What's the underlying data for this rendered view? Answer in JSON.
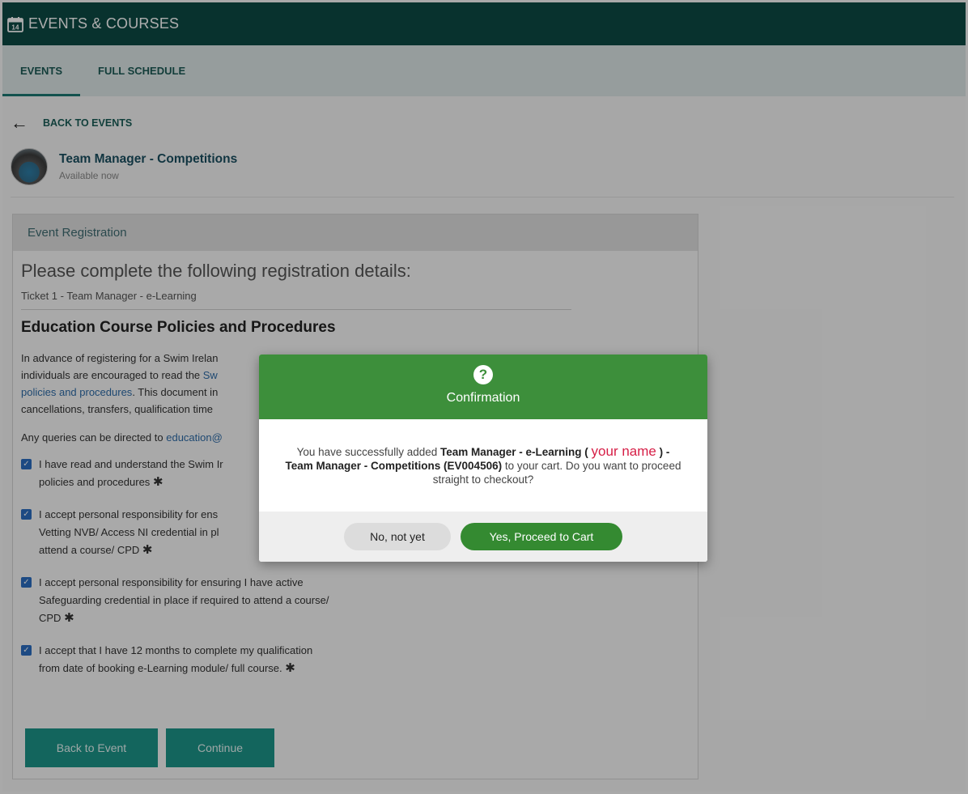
{
  "header": {
    "title": "EVENTS & COURSES",
    "icon": "calendar-icon"
  },
  "tabs": [
    {
      "label": "EVENTS",
      "active": true
    },
    {
      "label": "FULL SCHEDULE",
      "active": false
    }
  ],
  "back": {
    "label": "BACK TO EVENTS"
  },
  "event": {
    "title": "Team Manager - Competitions",
    "status": "Available now"
  },
  "registration": {
    "card_title": "Event Registration",
    "lead": "Please complete the following registration details:",
    "ticket": "Ticket 1 - Team Manager - e-Learning",
    "policy_title": "Education Course Policies and Procedures",
    "para1_a": "In advance of registering for a Swim Irelan",
    "para1_b": "individuals are encouraged to read the ",
    "para1_link_a": "Sw",
    "para1_link_b": "policies and procedures",
    "para1_c": ". This document in",
    "para1_d": "cancellations, transfers, qualification time",
    "para2_text": "Any queries can be directed to ",
    "para2_link": "education@",
    "checks": [
      {
        "line1": "I have read and understand the Swim Ir",
        "line2": "policies and procedures",
        "checked": true
      },
      {
        "line1": "I accept personal responsibility for ens",
        "line2": "Vetting NVB/ Access NI credential in pl",
        "line3": "attend a course/ CPD",
        "checked": true
      },
      {
        "line1": "I accept personal responsibility for ensuring I have active",
        "line2": "Safeguarding credential in place if required to attend a course/",
        "line3": "CPD",
        "checked": true
      },
      {
        "line1": "I accept that I have 12 months to complete my qualification",
        "line2": "from date of booking e-Learning module/ full course.",
        "checked": true
      }
    ],
    "required_mark": "✱",
    "buttons": {
      "back": "Back to Event",
      "continue": "Continue"
    }
  },
  "modal": {
    "icon": "question-icon",
    "title": "Confirmation",
    "msg_prefix": "You have successfully added ",
    "msg_bold1": "Team Manager - e-Learning (",
    "msg_red": "your name",
    "msg_bold2": ") - Team Manager - Competitions (EV004506)",
    "msg_suffix": " to your cart. Do you want to proceed straight to checkout?",
    "no_label": "No, not yet",
    "yes_label": "Yes, Proceed to Cart"
  },
  "colors": {
    "header_bg": "#0d4a45",
    "tabbar_bg": "#dde8e7",
    "teal_button": "#1c958a",
    "modal_green": "#3d8f3b",
    "highlight_red": "#d61e46"
  }
}
